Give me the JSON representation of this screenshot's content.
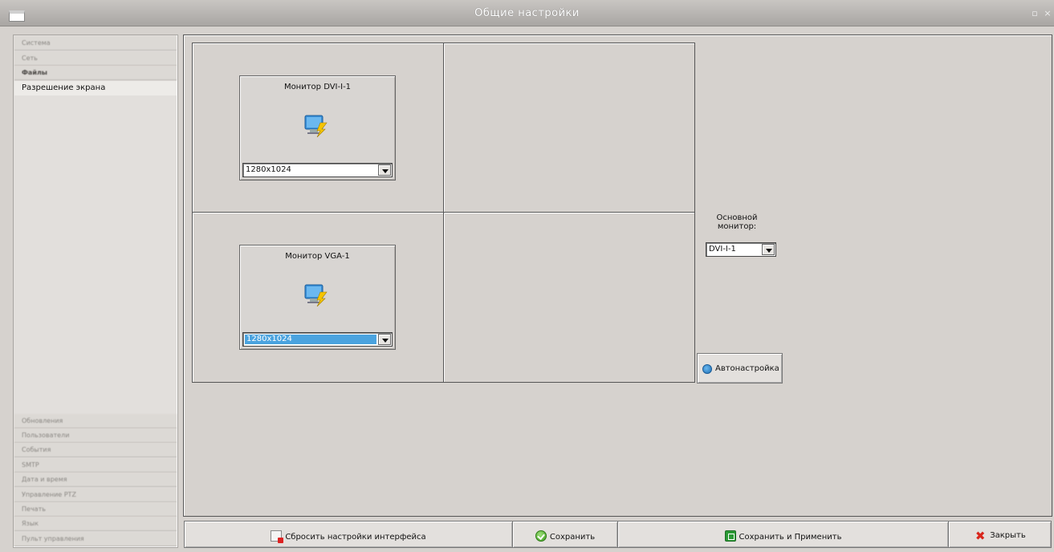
{
  "window": {
    "title": "Общие настройки",
    "controls": [
      "maximize",
      "close"
    ]
  },
  "sidebar": {
    "top_items": [
      {
        "label": "Система"
      },
      {
        "label": "Сеть"
      },
      {
        "label": "Файлы"
      },
      {
        "label": "Разрешение экрана",
        "active": true
      }
    ],
    "bottom_items": [
      {
        "label": "Обновления"
      },
      {
        "label": "Пользователи"
      },
      {
        "label": "События"
      },
      {
        "label": "SMTP"
      },
      {
        "label": "Дата и время"
      },
      {
        "label": "Управление PTZ"
      },
      {
        "label": "Печать"
      },
      {
        "label": "Язык"
      },
      {
        "label": "Пульт управления"
      }
    ]
  },
  "monitors": [
    {
      "title": "Монитор DVI-I-1",
      "resolution": "1280x1024",
      "selected": false
    },
    {
      "title": "Монитор VGA-1",
      "resolution": "1280x1024",
      "selected": true
    }
  ],
  "primary_monitor": {
    "label": "Основной монитор:",
    "value": "DVI-I-1"
  },
  "auto_button": {
    "label": "Автонастройка",
    "icon": "refresh-icon"
  },
  "footer": {
    "reset_label": "Сбросить настройки интерфейса",
    "save_label": "Сохранить",
    "save_apply_label": "Сохранить и Применить",
    "close_label": "Закрыть"
  },
  "colors": {
    "selection": "#4aa3df",
    "background": "#d6d2ce",
    "close_icon": "#d9261c",
    "save_icon": "#3a9b1e"
  }
}
